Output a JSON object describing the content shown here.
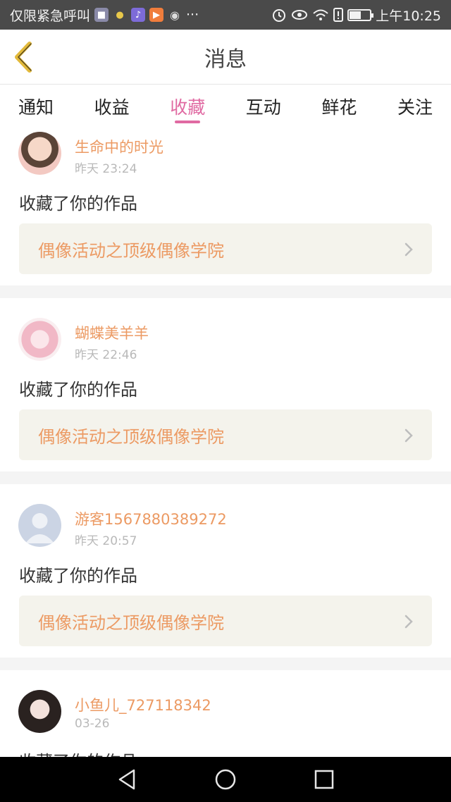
{
  "status_bar": {
    "carrier": "仅限紧急呼叫",
    "more": "···",
    "time": "上午10:25",
    "battery_level": 0.6
  },
  "header": {
    "title": "消息"
  },
  "tabs": [
    {
      "label": "通知",
      "active": false
    },
    {
      "label": "收益",
      "active": false
    },
    {
      "label": "收藏",
      "active": true
    },
    {
      "label": "互动",
      "active": false
    },
    {
      "label": "鲜花",
      "active": false
    },
    {
      "label": "关注",
      "active": false
    }
  ],
  "feed": [
    {
      "name": "生命中的时光",
      "time": "昨天 23:24",
      "action": "收藏了你的作品",
      "work": "偶像活动之顶级偶像学院"
    },
    {
      "name": "蝴蝶美羊羊",
      "time": "昨天 22:46",
      "action": "收藏了你的作品",
      "work": "偶像活动之顶级偶像学院"
    },
    {
      "name": "游客1567880389272",
      "time": "昨天 20:57",
      "action": "收藏了你的作品",
      "work": "偶像活动之顶级偶像学院"
    },
    {
      "name": "小鱼儿_727118342",
      "time": "03-26",
      "action": "收藏了你的作品",
      "work": ""
    }
  ],
  "colors": {
    "accent": "#e06aa2",
    "username": "#ec9a63",
    "back_icon": "#e2b93a"
  }
}
